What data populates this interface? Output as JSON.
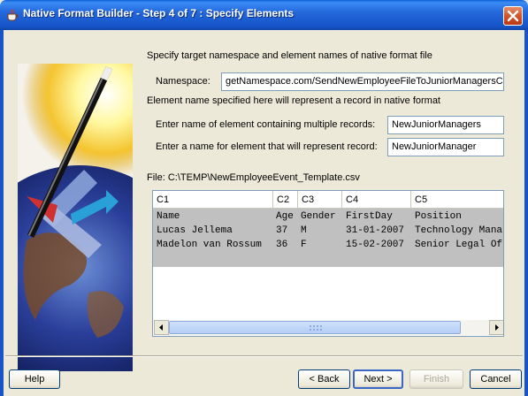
{
  "window": {
    "title": "Native Format Builder - Step 4 of 7 : Specify Elements"
  },
  "intro": "Specify target namespace and element names of native format file",
  "namespace": {
    "label": "Namespace:",
    "value": "getNamespace.com/SendNewEmployeeFileToJuniorManagersClub"
  },
  "element_note": "Element name specified here will represent a record in native format",
  "multi_records": {
    "label": "Enter name of element containing multiple records:",
    "value": "NewJuniorManagers"
  },
  "record": {
    "label": "Enter a name for element that will represent record:",
    "value": "NewJuniorManager"
  },
  "file_label": "File: C:\\TEMP\\NewEmployeeEvent_Template.csv",
  "grid": {
    "columns": [
      "C1",
      "C2",
      "C3",
      "C4",
      "C5"
    ],
    "rows": [
      [
        "Name",
        "Age",
        "Gender",
        "FirstDay",
        "Position"
      ],
      [
        "Lucas Jellema",
        "37",
        "M",
        "31-01-2007",
        "Technology Mana"
      ],
      [
        "Madelon van Rossum",
        "36",
        "F",
        "15-02-2007",
        "Senior Legal Of"
      ]
    ]
  },
  "buttons": {
    "help": "Help",
    "back": "< Back",
    "next": "Next >",
    "finish": "Finish",
    "cancel": "Cancel"
  }
}
